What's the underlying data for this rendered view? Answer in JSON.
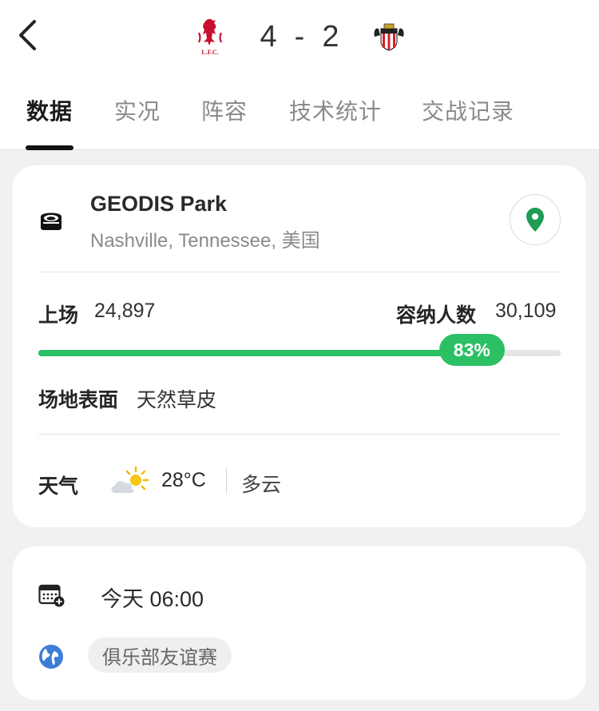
{
  "match": {
    "home_score": "4",
    "separator": "-",
    "away_score": "2",
    "home_crest_text": "L.F.C."
  },
  "tabs": [
    {
      "label": "数据",
      "active": true
    },
    {
      "label": "实况",
      "active": false
    },
    {
      "label": "阵容",
      "active": false
    },
    {
      "label": "技术统计",
      "active": false
    },
    {
      "label": "交战记录",
      "active": false
    }
  ],
  "venue": {
    "name": "GEODIS Park",
    "location": "Nashville, Tennessee, 美国",
    "icon": "stadium-icon",
    "map_icon": "map-pin-icon"
  },
  "attendance": {
    "label": "上场",
    "value": "24,897",
    "capacity_label": "容纳人数",
    "capacity_value": "30,109",
    "fill_percent": 83,
    "percent_text": "83%"
  },
  "surface": {
    "label": "场地表面",
    "value": "天然草皮"
  },
  "weather": {
    "label": "天气",
    "icon": "partly-cloudy-icon",
    "temperature": "28°C",
    "description": "多云"
  },
  "schedule": {
    "icon": "calendar-add-icon",
    "time": "今天 06:00",
    "competition_icon": "globe-icon",
    "competition": "俱乐部友谊赛"
  },
  "colors": {
    "accent_green": "#2bc064",
    "map_pin_green": "#1f9d55",
    "liverpool_red": "#c8102e",
    "sunderland_red": "#d2232a",
    "globe_blue": "#3b7dd8"
  }
}
